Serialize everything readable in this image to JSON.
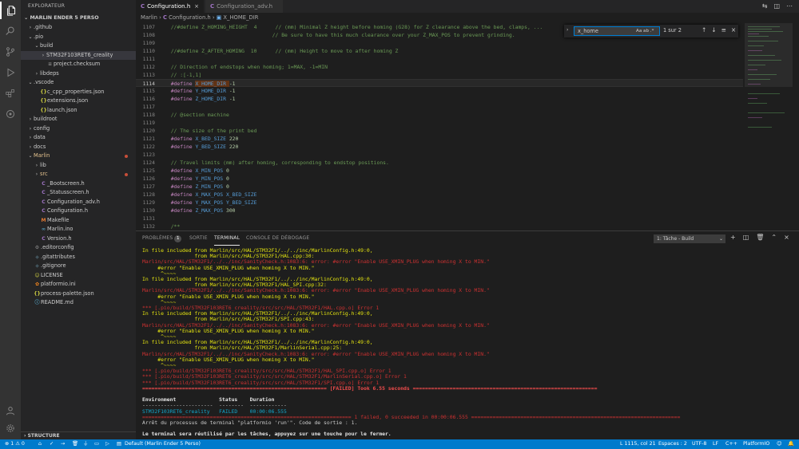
{
  "sidebar": {
    "title": "EXPLORATEUR",
    "project": "MARLIN ENDER 5 PERSO",
    "items": [
      {
        "label": ".github",
        "chev": "›",
        "icon": "",
        "indent": 1
      },
      {
        "label": ".pio",
        "chev": "⌄",
        "icon": "",
        "indent": 1
      },
      {
        "label": "build",
        "chev": "⌄",
        "icon": "",
        "indent": 2
      },
      {
        "label": "STM32F103RET6_creality",
        "chev": "›",
        "icon": "",
        "indent": 3,
        "selected": true
      },
      {
        "label": "project.checksum",
        "chev": "",
        "icon": "≡",
        "indent": 3
      },
      {
        "label": "libdeps",
        "chev": "›",
        "icon": "",
        "indent": 2
      },
      {
        "label": ".vscode",
        "chev": "⌄",
        "icon": "",
        "indent": 1
      },
      {
        "label": "c_cpp_properties.json",
        "chev": "",
        "icon": "{}",
        "indent": 2
      },
      {
        "label": "extensions.json",
        "chev": "",
        "icon": "{}",
        "indent": 2
      },
      {
        "label": "launch.json",
        "chev": "",
        "icon": "{}",
        "indent": 2
      },
      {
        "label": "buildroot",
        "chev": "›",
        "icon": "",
        "indent": 1
      },
      {
        "label": "config",
        "chev": "›",
        "icon": "",
        "indent": 1
      },
      {
        "label": "data",
        "chev": "›",
        "icon": "",
        "indent": 1
      },
      {
        "label": "docs",
        "chev": "›",
        "icon": "",
        "indent": 1
      },
      {
        "label": "Marlin",
        "chev": "⌄",
        "icon": "",
        "indent": 1,
        "modified": true
      },
      {
        "label": "lib",
        "chev": "›",
        "icon": "",
        "indent": 2
      },
      {
        "label": "src",
        "chev": "›",
        "icon": "",
        "indent": 2,
        "modified": true
      },
      {
        "label": "_Bootscreen.h",
        "chev": "",
        "icon": "C",
        "indent": 2
      },
      {
        "label": "_Statusscreen.h",
        "chev": "",
        "icon": "C",
        "indent": 2
      },
      {
        "label": "Configuration_adv.h",
        "chev": "",
        "icon": "C",
        "indent": 2
      },
      {
        "label": "Configuration.h",
        "chev": "",
        "icon": "C",
        "indent": 2
      },
      {
        "label": "Makefile",
        "chev": "",
        "icon": "M",
        "indent": 2
      },
      {
        "label": "Marlin.ino",
        "chev": "",
        "icon": "∞",
        "indent": 2
      },
      {
        "label": "Version.h",
        "chev": "",
        "icon": "C",
        "indent": 2
      },
      {
        "label": ".editorconfig",
        "chev": "",
        "icon": "⚙",
        "indent": 1
      },
      {
        "label": ".gitattributes",
        "chev": "",
        "icon": "◆",
        "indent": 1
      },
      {
        "label": ".gitignore",
        "chev": "",
        "icon": "◆",
        "indent": 1
      },
      {
        "label": "LICENSE",
        "chev": "",
        "icon": "☺",
        "indent": 1
      },
      {
        "label": "platformio.ini",
        "chev": "",
        "icon": "✿",
        "indent": 1
      },
      {
        "label": "process-palette.json",
        "chev": "",
        "icon": "{}",
        "indent": 1
      },
      {
        "label": "README.md",
        "chev": "",
        "icon": "ⓘ",
        "indent": 1
      }
    ],
    "structure": "STRUCTURE"
  },
  "tabs": [
    {
      "label": "Configuration.h",
      "active": true
    },
    {
      "label": "Configuration_adv.h",
      "active": false
    }
  ],
  "breadcrumb": {
    "root": "Marlin",
    "file": "Configuration.h",
    "symbol": "X_HOME_DIR"
  },
  "find": {
    "value": "x_home",
    "options": "Aa  ab  .*",
    "count": "1 sur 2"
  },
  "code": [
    {
      "n": "1107",
      "t": "  //#define Z_HOMING_HEIGHT  4      // (mm) Minimal Z height before homing (G28) for Z clearance above the bed, clamps, ...",
      "k": "cm"
    },
    {
      "n": "1108",
      "t": "                                   // Be sure to have this much clearance over your Z_MAX_POS to prevent grinding.",
      "k": "cm"
    },
    {
      "n": "1109",
      "t": "",
      "k": "cm"
    },
    {
      "n": "1110",
      "t": "  //#define Z_AFTER_HOMING  10      // (mm) Height to move to after homing Z",
      "k": "cm"
    },
    {
      "n": "1111",
      "t": "",
      "k": "cm"
    },
    {
      "n": "1112",
      "t": "  // Direction of endstops when homing; 1=MAX, -1=MIN",
      "k": "cm"
    },
    {
      "n": "1113",
      "t": "  // :[-1,1]",
      "k": "cm"
    },
    {
      "n": "1114",
      "t": "  #define X_HOME_DIR -1",
      "k": "def",
      "cur": true
    },
    {
      "n": "1115",
      "t": "  #define Y_HOME_DIR -1",
      "k": "def"
    },
    {
      "n": "1116",
      "t": "  #define Z_HOME_DIR -1",
      "k": "def"
    },
    {
      "n": "1117",
      "t": "",
      "k": "cm"
    },
    {
      "n": "1118",
      "t": "  // @section machine",
      "k": "cm"
    },
    {
      "n": "1119",
      "t": "",
      "k": "cm"
    },
    {
      "n": "1120",
      "t": "  // The size of the print bed",
      "k": "cm"
    },
    {
      "n": "1121",
      "t": "  #define X_BED_SIZE 220",
      "k": "def"
    },
    {
      "n": "1122",
      "t": "  #define Y_BED_SIZE 220",
      "k": "def"
    },
    {
      "n": "1123",
      "t": "",
      "k": "cm"
    },
    {
      "n": "1124",
      "t": "  // Travel limits (mm) after homing, corresponding to endstop positions.",
      "k": "cm"
    },
    {
      "n": "1125",
      "t": "  #define X_MIN_POS 0",
      "k": "def"
    },
    {
      "n": "1126",
      "t": "  #define Y_MIN_POS 0",
      "k": "def"
    },
    {
      "n": "1127",
      "t": "  #define Z_MIN_POS 0",
      "k": "def"
    },
    {
      "n": "1128",
      "t": "  #define X_MAX_POS X_BED_SIZE",
      "k": "def"
    },
    {
      "n": "1129",
      "t": "  #define Y_MAX_POS Y_BED_SIZE",
      "k": "def"
    },
    {
      "n": "1130",
      "t": "  #define Z_MAX_POS 300",
      "k": "def"
    },
    {
      "n": "1131",
      "t": "",
      "k": "cm"
    },
    {
      "n": "1132",
      "t": "  /**",
      "k": "cm"
    },
    {
      "n": "1133",
      "t": "   * Software Endstops",
      "k": "cm"
    }
  ],
  "panel": {
    "tabs": [
      {
        "label": "PROBLÈMES",
        "badge": "1"
      },
      {
        "label": "SORTIE",
        "badge": ""
      },
      {
        "label": "TERMINAL",
        "badge": "",
        "active": true
      },
      {
        "label": "CONSOLE DE DÉBOGAGE",
        "badge": ""
      }
    ],
    "task": "1: Tâche - Build"
  },
  "terminal": [
    {
      "t": "In file included from Marlin/src/HAL/STM32F1/../../inc/MarlinConfig.h:49:0,",
      "c": "t-y"
    },
    {
      "t": "                 from Marlin/src/HAL/STM32F1/HAL.cpp:30:",
      "c": "t-y"
    },
    {
      "t": "Marlin/src/HAL/STM32F1/../../inc/SanityCheck.h:1083:6: error: #error \"Enable USE_XMIN_PLUG when homing X to MIN.\"",
      "c": "t-r"
    },
    {
      "t": "     #error \"Enable USE_XMIN_PLUG when homing X to MIN.\"",
      "c": "t-y"
    },
    {
      "t": "      ^~~~~",
      "c": "t-y"
    },
    {
      "t": "In file included from Marlin/src/HAL/STM32F1/../../inc/MarlinConfig.h:49:0,",
      "c": "t-y"
    },
    {
      "t": "                 from Marlin/src/HAL/STM32F1/HAL_SPI.cpp:32:",
      "c": "t-y"
    },
    {
      "t": "Marlin/src/HAL/STM32F1/../../inc/SanityCheck.h:1083:6: error: #error \"Enable USE_XMIN_PLUG when homing X to MIN.\"",
      "c": "t-r"
    },
    {
      "t": "     #error \"Enable USE_XMIN_PLUG when homing X to MIN.\"",
      "c": "t-y"
    },
    {
      "t": "      ^~~~~",
      "c": "t-y"
    },
    {
      "t": "*** [.pio/build/STM32F103RET6_creality/src/src/HAL/STM32F1/HAL.cpp.o] Error 1",
      "c": "t-r"
    },
    {
      "t": "In file included from Marlin/src/HAL/STM32F1/../../inc/MarlinConfig.h:49:0,",
      "c": "t-y"
    },
    {
      "t": "                 from Marlin/src/HAL/STM32F1/SPI.cpp:43:",
      "c": "t-y"
    },
    {
      "t": "Marlin/src/HAL/STM32F1/../../inc/SanityCheck.h:1083:6: error: #error \"Enable USE_XMIN_PLUG when homing X to MIN.\"",
      "c": "t-r"
    },
    {
      "t": "     #error \"Enable USE_XMIN_PLUG when homing X to MIN.\"",
      "c": "t-y"
    },
    {
      "t": "      ^~~~~",
      "c": "t-y"
    },
    {
      "t": "In file included from Marlin/src/HAL/STM32F1/../../inc/MarlinConfig.h:49:0,",
      "c": "t-y"
    },
    {
      "t": "                 from Marlin/src/HAL/STM32F1/MarlinSerial.cpp:25:",
      "c": "t-y"
    },
    {
      "t": "Marlin/src/HAL/STM32F1/../../inc/SanityCheck.h:1083:6: error: #error \"Enable USE_XMIN_PLUG when homing X to MIN.\"",
      "c": "t-r"
    },
    {
      "t": "     #error \"Enable USE_XMIN_PLUG when homing X to MIN.\"",
      "c": "t-y"
    },
    {
      "t": "      ^~~~~",
      "c": "t-y"
    },
    {
      "t": "*** [.pio/build/STM32F103RET6_creality/src/src/HAL/STM32F1/HAL_SPI.cpp.o] Error 1",
      "c": "t-r"
    },
    {
      "t": "*** [.pio/build/STM32F103RET6_creality/src/src/HAL/STM32F1/MarlinSerial.cpp.o] Error 1",
      "c": "t-r"
    },
    {
      "t": "*** [.pio/build/STM32F103RET6_creality/src/src/HAL/STM32F1/SPI.cpp.o] Error 1",
      "c": "t-r"
    },
    {
      "t": "============================================================ [FAILED] Took 6.55 seconds ============================================================",
      "c": "t-rb"
    },
    {
      "t": "",
      "c": "t-w"
    },
    {
      "t": "Environment              Status    Duration",
      "c": "t-b"
    },
    {
      "t": "-----------------------  --------  ------------",
      "c": "t-w"
    },
    {
      "t": "STM32F103RET6_creality   FAILED    00:00:06.555",
      "c": "t-row"
    },
    {
      "t": "==================================================================== 1 failed, 0 succeeded in 00:00:06.555 ====================================================================",
      "c": "t-r"
    },
    {
      "t": "Arrêt du processus de terminal \"platformio 'run'\". Code de sortie : 1.",
      "c": "t-w"
    },
    {
      "t": "",
      "c": "t-w"
    },
    {
      "t": "Le terminal sera réutilisé par les tâches, appuyez sur une touche pour le fermer.",
      "c": "t-b"
    }
  ],
  "status": {
    "errors": "⊗ 1  ⚠ 0",
    "play": "▷",
    "default": "Default (Marlin Ender 5 Perso)",
    "position": "L 1115, col 21",
    "spaces": "Espaces : 2",
    "encoding": "UTF-8",
    "eol": "LF",
    "language": "C++",
    "platform": "PlatformIO"
  },
  "colors": {
    "accent": "#007acc",
    "activity_bar": "#333333",
    "sidebar": "#252526",
    "editor": "#1e1e1e",
    "error": "#cd3131",
    "warning": "#e5e510"
  }
}
